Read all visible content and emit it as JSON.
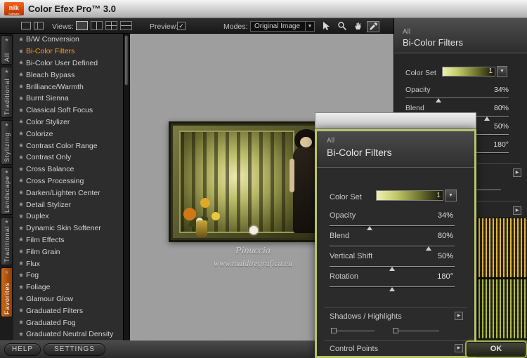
{
  "titlebar": {
    "logo_top": "nik",
    "logo_sub": "Software",
    "title": "Color Efex Pro™ 3.0"
  },
  "toolbar": {
    "views_label": "Views:",
    "preview_label": "Preview:",
    "modes_label": "Modes:",
    "modes_value": "Original Image"
  },
  "tabs": {
    "items": [
      {
        "label": "All"
      },
      {
        "label": "Traditional"
      },
      {
        "label": "Stylizing"
      },
      {
        "label": "Landscape"
      },
      {
        "label": "Traditional"
      },
      {
        "label": "Favorites"
      }
    ]
  },
  "filters": {
    "selected": "Bi-Color Filters",
    "items": [
      {
        "label": "B/W Conversion"
      },
      {
        "label": "Bi-Color Filters"
      },
      {
        "label": "Bi-Color User Defined"
      },
      {
        "label": "Bleach Bypass"
      },
      {
        "label": "Brilliance/Warmth"
      },
      {
        "label": "Burnt Sienna"
      },
      {
        "label": "Classical Soft Focus"
      },
      {
        "label": "Color Stylizer"
      },
      {
        "label": "Colorize"
      },
      {
        "label": "Contrast Color Range"
      },
      {
        "label": "Contrast Only"
      },
      {
        "label": "Cross Balance"
      },
      {
        "label": "Cross Processing"
      },
      {
        "label": "Darken/Lighten Center"
      },
      {
        "label": "Detail Stylizer"
      },
      {
        "label": "Duplex"
      },
      {
        "label": "Dynamic Skin Softener"
      },
      {
        "label": "Film Effects"
      },
      {
        "label": "Film Grain"
      },
      {
        "label": "Flux"
      },
      {
        "label": "Fog"
      },
      {
        "label": "Foliage"
      },
      {
        "label": "Glamour Glow"
      },
      {
        "label": "Graduated Filters"
      },
      {
        "label": "Graduated Fog"
      },
      {
        "label": "Graduated Neutral Density"
      }
    ]
  },
  "preview": {
    "caption1": "Pinuccia",
    "caption2": "www.maldiregrafica.eu"
  },
  "panel": {
    "category": "All",
    "title": "Bi-Color Filters",
    "color_set_label": "Color Set",
    "color_set_value": "1",
    "sliders": [
      {
        "label": "Opacity",
        "value": "34%",
        "pos": 32
      },
      {
        "label": "Blend",
        "value": "80%",
        "pos": 79
      },
      {
        "label": "Vertical Shift",
        "value": "50%",
        "pos": 50
      },
      {
        "label": "Rotation",
        "value": "180°",
        "pos": 50
      }
    ],
    "sections": [
      {
        "label": "Shadows / Highlights"
      },
      {
        "label": "Control Points"
      }
    ]
  },
  "footer": {
    "help": "HELP",
    "settings": "SETTINGS",
    "ok": "OK"
  },
  "icons": {
    "star": "★",
    "check": "✓",
    "dropdown_arrow": "▼",
    "expander_arrow": "▶"
  },
  "colors": {
    "accent_orange": "#ff9a1e",
    "panel_border_green": "#b7c46c"
  }
}
